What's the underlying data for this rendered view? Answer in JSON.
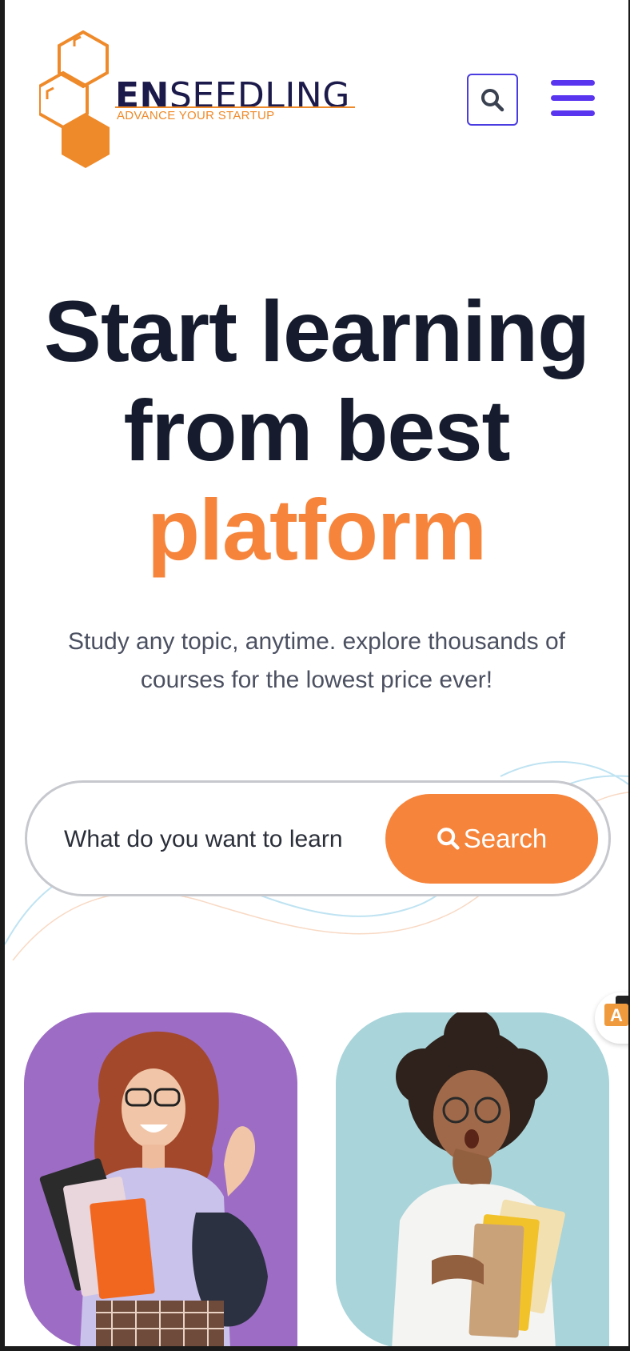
{
  "brand": {
    "name_bold": "EN",
    "name_regular": "SEEDLING",
    "tagline": "ADVANCE YOUR STARTUP"
  },
  "header": {
    "search_icon": "search-icon",
    "menu_icon": "hamburger-menu-icon"
  },
  "hero": {
    "title_line1": "Start learning",
    "title_line2": "from best",
    "title_accent": "platform",
    "subtitle": "Study any topic, anytime. explore thousands of courses for the lowest price ever!"
  },
  "search": {
    "placeholder": "What do you want to learn",
    "button_label": "Search"
  },
  "colors": {
    "accent_orange": "#f6843b",
    "brand_purple": "#5a35f0",
    "heading_dark": "#161c2d"
  }
}
